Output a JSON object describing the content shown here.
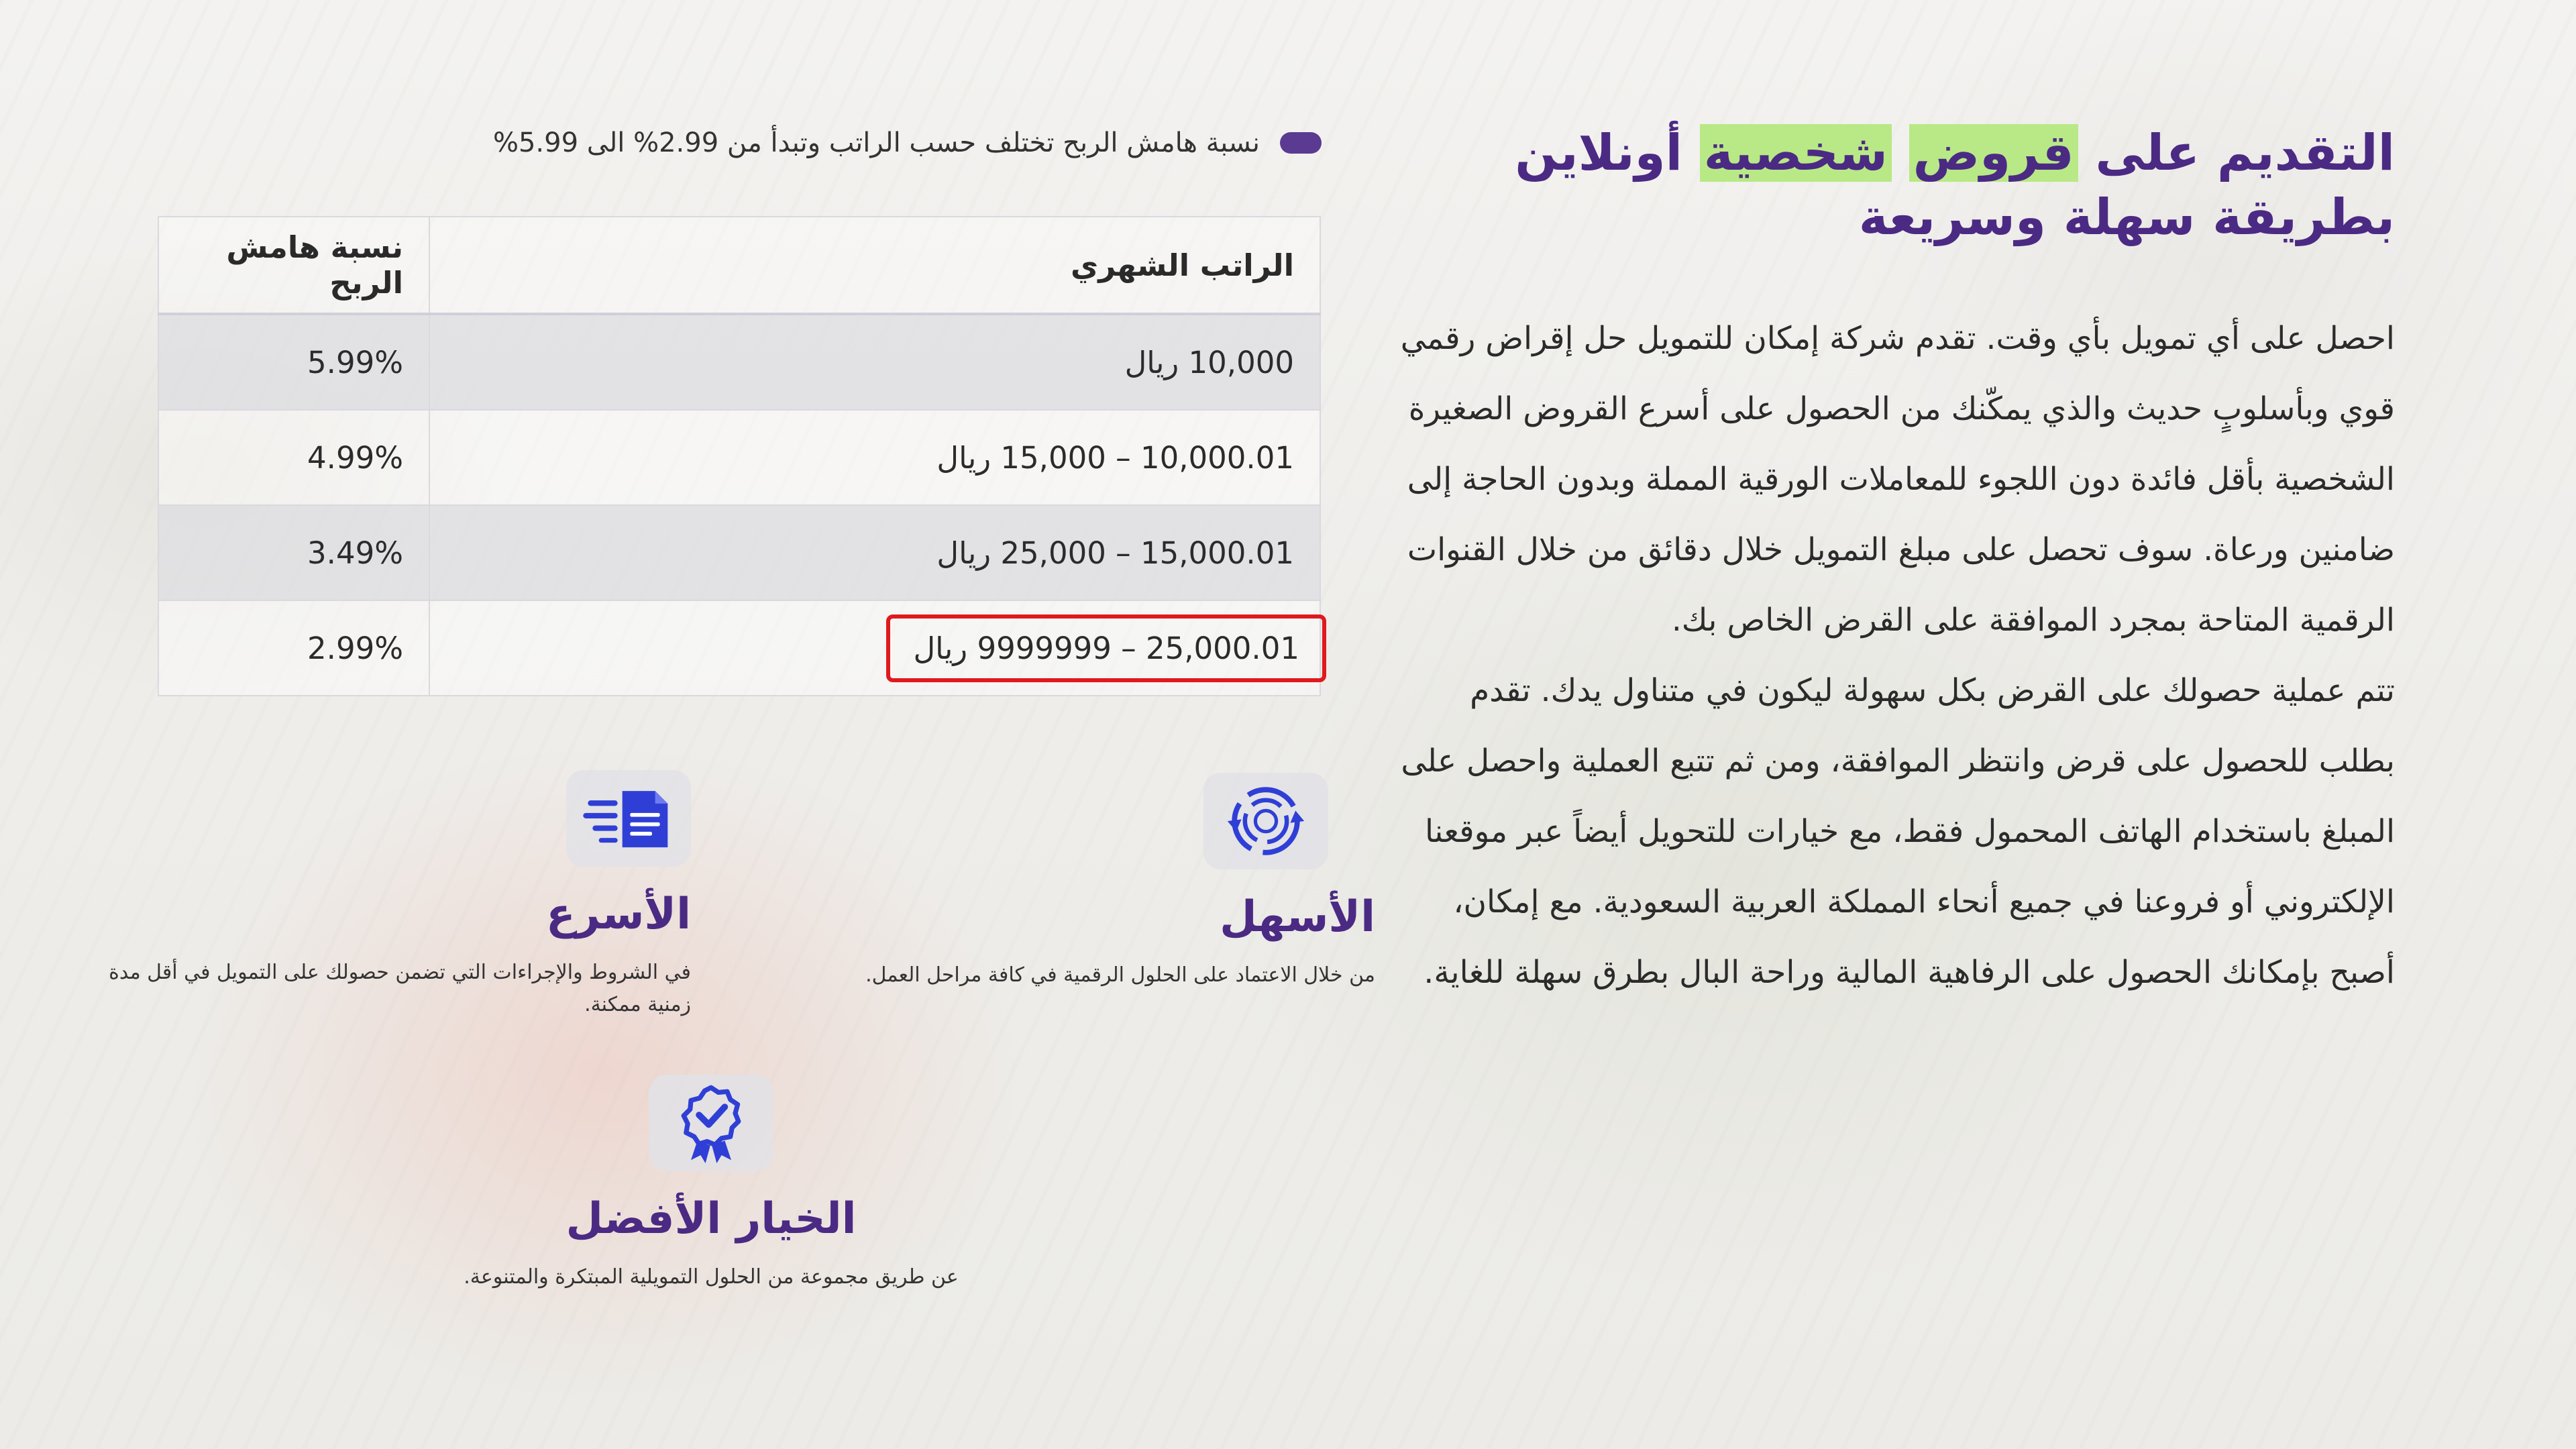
{
  "hero": {
    "title_part1": "التقديم على ",
    "title_hl1": "قروض",
    "title_space": " ",
    "title_hl2": "شخصية",
    "title_part2": " أونلاين",
    "title_line2": "بطريقة سهلة وسريعة",
    "paragraph1": "احصل على أي تمويل بأي وقت. تقدم شركة إمكان للتمويل حل إقراض رقمي قوي وبأسلوبٍ حديث والذي يمكّنك من الحصول على أسرع القروض الصغيرة الشخصية بأقل فائدة دون اللجوء للمعاملات الورقية المملة وبدون الحاجة إلى ضامنين ورعاة. سوف تحصل على مبلغ التمويل خلال دقائق من خلال القنوات الرقمية المتاحة بمجرد الموافقة على القرض الخاص بك.",
    "paragraph2": "تتم عملية حصولك على القرض بكل سهولة ليكون في متناول يدك. تقدم بطلب للحصول على قرض وانتظر الموافقة، ومن ثم تتبع العملية واحصل على المبلغ باستخدام الهاتف المحمول فقط، مع خيارات للتحويل أيضاً عبر موقعنا الإلكتروني أو فروعنا في جميع أنحاء المملكة العربية السعودية. مع إمكان، أصبح بإمكانك الحصول على الرفاهية المالية وراحة البال بطرق سهلة للغاية."
  },
  "note": {
    "text": "نسبة هامش الربح تختلف حسب الراتب وتبدأ من 2.99% الى 5.99%"
  },
  "table": {
    "header_salary": "الراتب الشهري",
    "header_rate": "نسبة هامش الربح",
    "rows": [
      {
        "salary": "10,000 ريال",
        "rate": "5.99%"
      },
      {
        "salary": "10,000.01 – 15,000 ريال",
        "rate": "4.99%"
      },
      {
        "salary": "15,000.01 – 25,000 ريال",
        "rate": "3.49%"
      },
      {
        "salary": "25,000.01 – 9999999 ريال",
        "rate": "2.99%"
      }
    ]
  },
  "features": {
    "easy": {
      "title": "الأسهل",
      "desc": "من خلال الاعتماد على الحلول الرقمية في كافة مراحل العمل.",
      "icon": "circular-arrows-icon"
    },
    "fast": {
      "title": "الأسرع",
      "desc": "في الشروط والإجراءات التي تضمن حصولك على التمويل في أقل مدة زمنية ممكنة.",
      "icon": "fast-document-icon"
    },
    "best": {
      "title": "الخيار الأفضل",
      "desc": "عن طريق مجموعة من الحلول التمويلية المبتكرة والمتنوعة.",
      "icon": "award-badge-icon"
    }
  },
  "colors": {
    "brand_purple": "#4b2a83",
    "highlight_green": "#b8e986",
    "icon_blue": "#2f3fd6",
    "selection_red": "#e0191e"
  }
}
